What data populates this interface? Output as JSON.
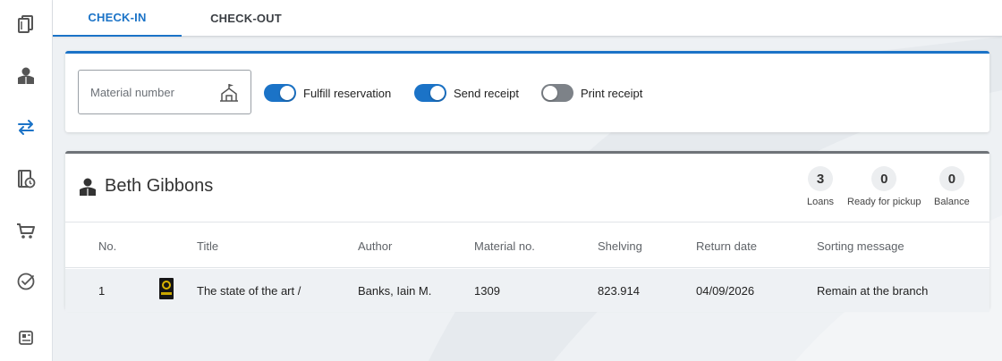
{
  "rail": {
    "items": [
      {
        "icon": "books-icon"
      },
      {
        "icon": "patron-icon"
      },
      {
        "icon": "swap-icon",
        "active": true
      },
      {
        "icon": "due-book-icon"
      },
      {
        "icon": "cart-icon"
      },
      {
        "icon": "check-circle-icon"
      },
      {
        "icon": "report-icon"
      }
    ],
    "accent": "#1b73c7"
  },
  "tabs": [
    {
      "label": "CHECK-IN",
      "active": true
    },
    {
      "label": "CHECK-OUT",
      "active": false
    }
  ],
  "action": {
    "material_placeholder": "Material number",
    "toggles": [
      {
        "label": "Fulfill reservation",
        "on": true
      },
      {
        "label": "Send receipt",
        "on": true
      },
      {
        "label": "Print receipt",
        "on": false
      }
    ]
  },
  "patron": {
    "name": "Beth Gibbons",
    "stats": [
      {
        "value": "3",
        "label": "Loans"
      },
      {
        "value": "0",
        "label": "Ready for pickup"
      },
      {
        "value": "0",
        "label": "Balance"
      }
    ]
  },
  "table": {
    "columns": [
      "No.",
      "Title",
      "Author",
      "Material no.",
      "Shelving",
      "Return date",
      "Sorting message"
    ],
    "rows": [
      {
        "no": "1",
        "title": "The state of the art /",
        "author": "Banks, Iain M.",
        "material_no": "1309",
        "shelving": "823.914",
        "return_date": "04/09/2026",
        "sorting_message": "Remain at the branch"
      }
    ]
  }
}
